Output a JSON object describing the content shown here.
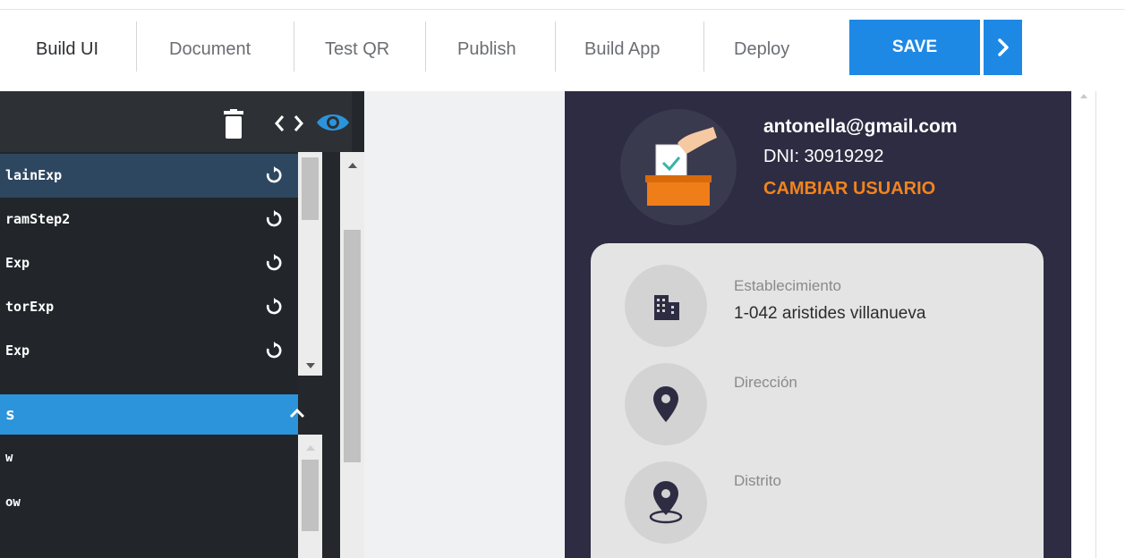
{
  "toolbar": {
    "tabs": [
      {
        "label": "Build UI"
      },
      {
        "label": "Document"
      },
      {
        "label": "Test QR"
      },
      {
        "label": "Publish"
      },
      {
        "label": "Build App"
      },
      {
        "label": "Deploy"
      }
    ],
    "save_label": "SAVE",
    "accent_color": "#1e88e5"
  },
  "left_panel": {
    "header_icons": [
      "trash-icon",
      "code-icon",
      "eye-icon"
    ],
    "items": [
      {
        "label": "lainExp",
        "selected": true
      },
      {
        "label": "ramStep2",
        "selected": false
      },
      {
        "label": "Exp",
        "selected": false
      },
      {
        "label": "torExp",
        "selected": false
      },
      {
        "label": "Exp",
        "selected": false
      }
    ],
    "section": {
      "label": "s",
      "expanded": true
    },
    "sub_items": [
      {
        "label": "w"
      },
      {
        "label": "ow"
      }
    ]
  },
  "preview": {
    "user": {
      "email": "antonella@gmail.com",
      "dni": "DNI: 30919292",
      "change_user": "CAMBIAR USUARIO"
    },
    "fields": [
      {
        "icon": "building-icon",
        "label": "Establecimiento",
        "value": "1-042 aristides villanueva"
      },
      {
        "icon": "location-pin-icon",
        "label": "Dirección",
        "value": ""
      },
      {
        "icon": "map-pin-icon",
        "label": "Distrito",
        "value": ""
      }
    ],
    "colors": {
      "background": "#2d2c42",
      "highlight": "#f2841d",
      "card": "#e4e4e4"
    }
  }
}
